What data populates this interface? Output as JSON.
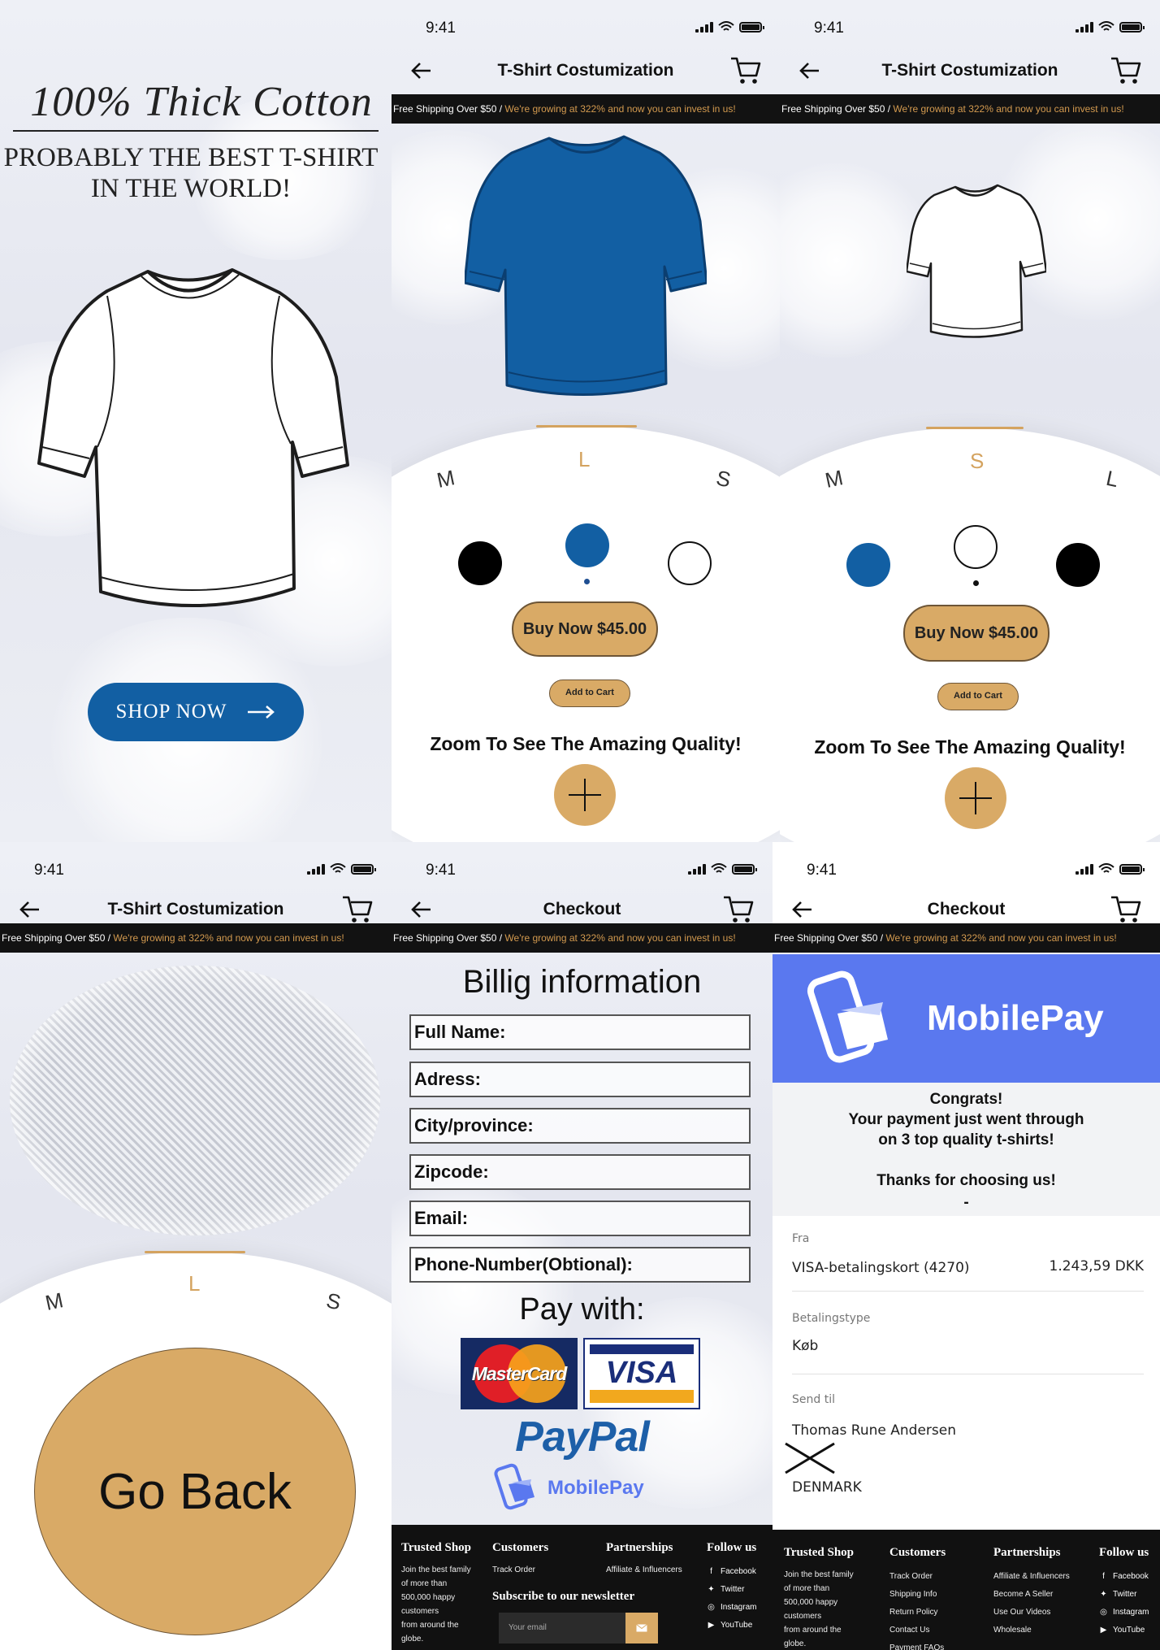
{
  "status": {
    "time": "9:41"
  },
  "ticker": {
    "left": "Free Shipping Over $50 / ",
    "right": "We're growing at 322% and now you can invest in us!"
  },
  "landing": {
    "headline": "100% Thick Cotton",
    "sub1": "PROBABLY THE BEST T-SHIRT",
    "sub2": "IN THE WORLD!",
    "shop_label": "SHOP NOW"
  },
  "customize": {
    "title": "T-Shirt Costumization",
    "sizes_blue": [
      "M",
      "L",
      "S"
    ],
    "sizes_white": [
      "M",
      "S",
      "L"
    ],
    "buy_label": "Buy Now $45.00",
    "add_label": "Add to Cart",
    "zoom_label": "Zoom To See The Amazing Quality!"
  },
  "zoom": {
    "title": "T-Shirt Costumization",
    "sizes": [
      "M",
      "L",
      "S"
    ],
    "back_label": "Go Back"
  },
  "checkout": {
    "title": "Checkout",
    "billing_title": "Billig information",
    "fields": [
      "Full Name:",
      "Adress:",
      "City/province:",
      "Zipcode:",
      "Email:",
      "Phone-Number(Obtional):"
    ],
    "pay_with": "Pay with:",
    "mastercard": "MasterCard",
    "visa": "VISA",
    "paypal": "PayPal",
    "mobilepay": "MobilePay"
  },
  "confirm": {
    "brand": "MobilePay",
    "congrats": "Congrats!",
    "line2": "Your payment just went through",
    "line3": "on 3 top quality t-shirts!",
    "thanks": "Thanks for choosing us!",
    "dash": "-",
    "fra_label": "Fra",
    "card": "VISA-betalingskort (4270)",
    "amount": "1.243,59 DKK",
    "type_label": "Betalingstype",
    "type_value": "Køb",
    "send_label": "Send til",
    "name": "Thomas  Rune Andersen",
    "country": "DENMARK"
  },
  "footer": {
    "trusted_title": "Trusted Shop",
    "trusted_text": [
      "Join the  best  family",
      "of more than",
      "500,000 happy",
      "customers",
      "from around the",
      "globe."
    ],
    "customers_title": "Customers",
    "customers_short": [
      "Track Order"
    ],
    "customers_full": [
      "Track Order",
      "Shipping Info",
      "Return Policy",
      "Contact Us",
      "Payment FAQs"
    ],
    "partner_title": "Partnerships",
    "partner_short": [
      "Affiliate & Influencers"
    ],
    "partner_full": [
      "Affiliate & Influencers",
      "Become A Seller",
      "Use Our Videos",
      "Wholesale"
    ],
    "follow_title": "Follow us",
    "follow": [
      "Facebook",
      "Twitter",
      "Instagram",
      "YouTube"
    ],
    "newsletter_title": "Subscribe to our newsletter",
    "email_placeholder": "Your email"
  },
  "colors": {
    "gold": "#d9aa66",
    "blue": "#125fa3",
    "mobilepay": "#5a78ef",
    "ticker_accent": "#d39a4f"
  }
}
